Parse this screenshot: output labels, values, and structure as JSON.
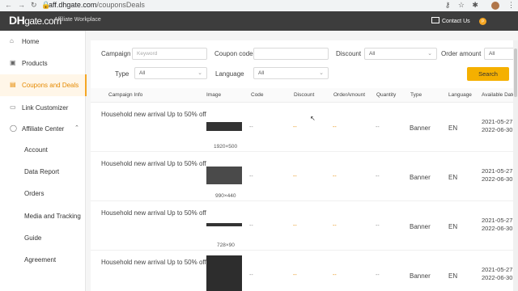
{
  "browser": {
    "domain": "aff.dhgate.com",
    "path": "/couponsDeals"
  },
  "header": {
    "logo_main": "DH",
    "logo_rest": "gate.com",
    "subtitle": "Affiliate Workplace",
    "contact": "Contact Us",
    "user_initial": "p"
  },
  "sidebar": {
    "items": [
      {
        "label": "Home",
        "icon": "home-icon"
      },
      {
        "label": "Products",
        "icon": "box-icon"
      },
      {
        "label": "Coupons and Deals",
        "icon": "coupon-icon",
        "active": true
      },
      {
        "label": "Link Customizer",
        "icon": "link-icon"
      },
      {
        "label": "Affiliate Center",
        "icon": "user-icon"
      }
    ],
    "subitems": [
      "Account",
      "Data Report",
      "Orders",
      "Media and Tracking",
      "Guide",
      "Agreement"
    ]
  },
  "filters": {
    "campaign_label": "Campaign",
    "campaign_placeholder": "Keyword",
    "coupon_label": "Coupon code",
    "discount_label": "Discount",
    "discount_value": "All",
    "order_amount_label": "Order amount",
    "order_amount_value": "All",
    "type_label": "Type",
    "type_value": "All",
    "language_label": "Language",
    "language_value": "All",
    "search_label": "Search"
  },
  "table": {
    "columns": [
      "Campaign Info",
      "Image",
      "Code",
      "Discount",
      "OrderAmount",
      "Quantity",
      "Type",
      "Language",
      "Available Date"
    ],
    "rows": [
      {
        "info": "Household new arrival Up to 50% off",
        "size": "1920×500",
        "code": "--",
        "discount": "--",
        "order_amount": "--",
        "quantity": "--",
        "type": "Banner",
        "lang": "EN",
        "start": "2021-05-27",
        "end": "2022-06-30"
      },
      {
        "info": "Household new arrival Up to 50% off",
        "size": "990×440",
        "code": "--",
        "discount": "--",
        "order_amount": "--",
        "quantity": "--",
        "type": "Banner",
        "lang": "EN",
        "start": "2021-05-27",
        "end": "2022-06-30"
      },
      {
        "info": "Household new arrival Up to 50% off",
        "size": "728×90",
        "code": "--",
        "discount": "--",
        "order_amount": "--",
        "quantity": "--",
        "type": "Banner",
        "lang": "EN",
        "start": "2021-05-27",
        "end": "2022-06-30"
      },
      {
        "info": "Household new arrival Up to 50% off",
        "size": "",
        "code": "--",
        "discount": "--",
        "order_amount": "--",
        "quantity": "--",
        "type": "Banner",
        "lang": "EN",
        "start": "2021-05-27",
        "end": "2022-06-30"
      }
    ]
  },
  "colors": {
    "accent": "#f5a623",
    "header_bg": "#3d3d3d",
    "button": "#f5b000"
  }
}
